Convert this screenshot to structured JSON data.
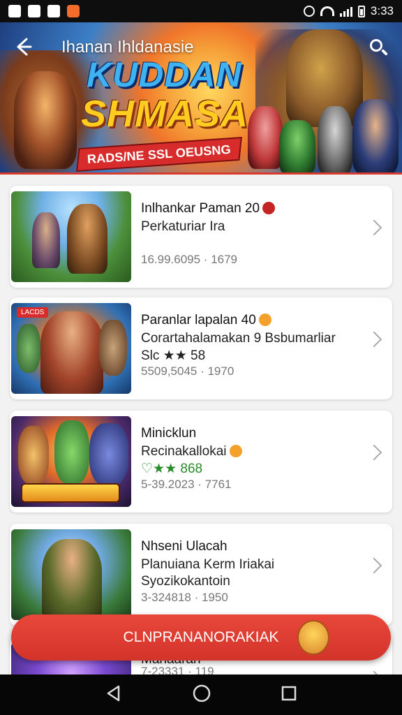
{
  "status_bar": {
    "time": "3:33",
    "left_icons": [
      "image-icon",
      "calendar-icon",
      "sync-icon",
      "app-icon"
    ],
    "right_icons": [
      "alarm-icon",
      "wifi-icon",
      "signal-icon",
      "battery-icon"
    ]
  },
  "hero": {
    "title": "Ihanan Ihldanasie",
    "logo_line1": "KUDDAN",
    "logo_line2": "SHMASA",
    "ribbon": "RADS/NE SSL OEUSNG",
    "colors": {
      "sky": "#3c7fc7",
      "sun": "#ffd75e",
      "logo_blue": "#3fb3f1",
      "logo_gold": "#ffcc1f",
      "ribbon": "#d82c2c"
    }
  },
  "list": {
    "items": [
      {
        "title": "Inlhankar Paman 20",
        "subtitle": "Perkaturiar Ira",
        "meta": "16.99.6095 · 1679",
        "badge": "red-badge-icon",
        "tag": ""
      },
      {
        "title": "Paranlar lapalan 40",
        "subtitle": "Corartahalamakan 9 Bsbumarliar",
        "subtitle2": "Slc ★★ 58",
        "meta": "5509,5045 · 1970",
        "badge": "orange-badge-icon",
        "tag": "LACDS"
      },
      {
        "title": "Minicklun",
        "subtitle": "Recinakallokai",
        "subtitle2": "♡★★ 868",
        "meta": "5-39.2023 · 7761",
        "badge": "orange-badge-icon",
        "tag": ""
      },
      {
        "title": "Nhseni Ulacah",
        "subtitle": "Planuiana Kerm Iriakai",
        "subtitle2": "Syozikokantoin",
        "meta": "3-324818 · 1950",
        "badge": "",
        "tag": ""
      },
      {
        "title": "Manaaran",
        "subtitle": "",
        "meta": "7-23331 · 119",
        "badge": "",
        "tag": ""
      }
    ]
  },
  "cta": {
    "label": "CLNPRANANORAKIAK"
  },
  "nav": {
    "back": "back-icon",
    "home": "home-icon",
    "recent": "recent-apps-icon"
  }
}
